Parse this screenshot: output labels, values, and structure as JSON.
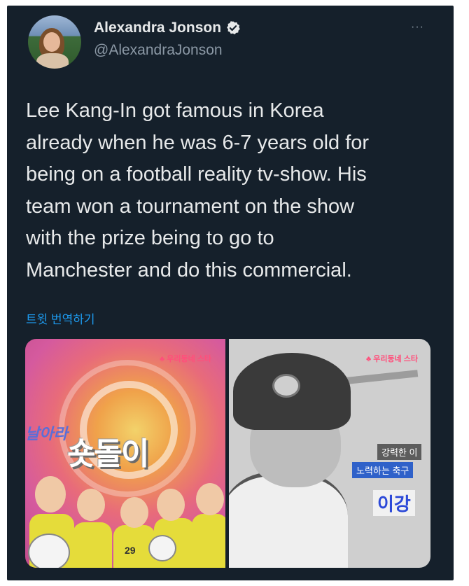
{
  "user": {
    "display_name": "Alexandra Jonson",
    "handle": "@AlexandraJonson",
    "verified": true,
    "avatar_icon": "profile-photo"
  },
  "more_label": "···",
  "tweet": {
    "text": "Lee Kang-In got famous in Korea\nalready when he was 6-7 years old for\nbeing on a football reality tv-show. His\nteam won a tournament on the show\nwith the prize being to go to\nManchester and do this commercial.",
    "translate_label": "트윗 번역하기"
  },
  "media": {
    "left_image": {
      "logo_text": "숏돌이",
      "logo_text_small": "날아라",
      "corner_logo": "♣ 우리동네 스타",
      "jersey_number": "29"
    },
    "right_image": {
      "corner_logo": "♣ 우리동네 스타",
      "caption_line1": "강력한 이",
      "caption_line2": "노력하는 축구",
      "caption_name": "이강"
    }
  },
  "colors": {
    "background": "#15202b",
    "text_primary": "#e7e9ea",
    "text_secondary": "#8b98a5",
    "link": "#1d9bf0"
  }
}
